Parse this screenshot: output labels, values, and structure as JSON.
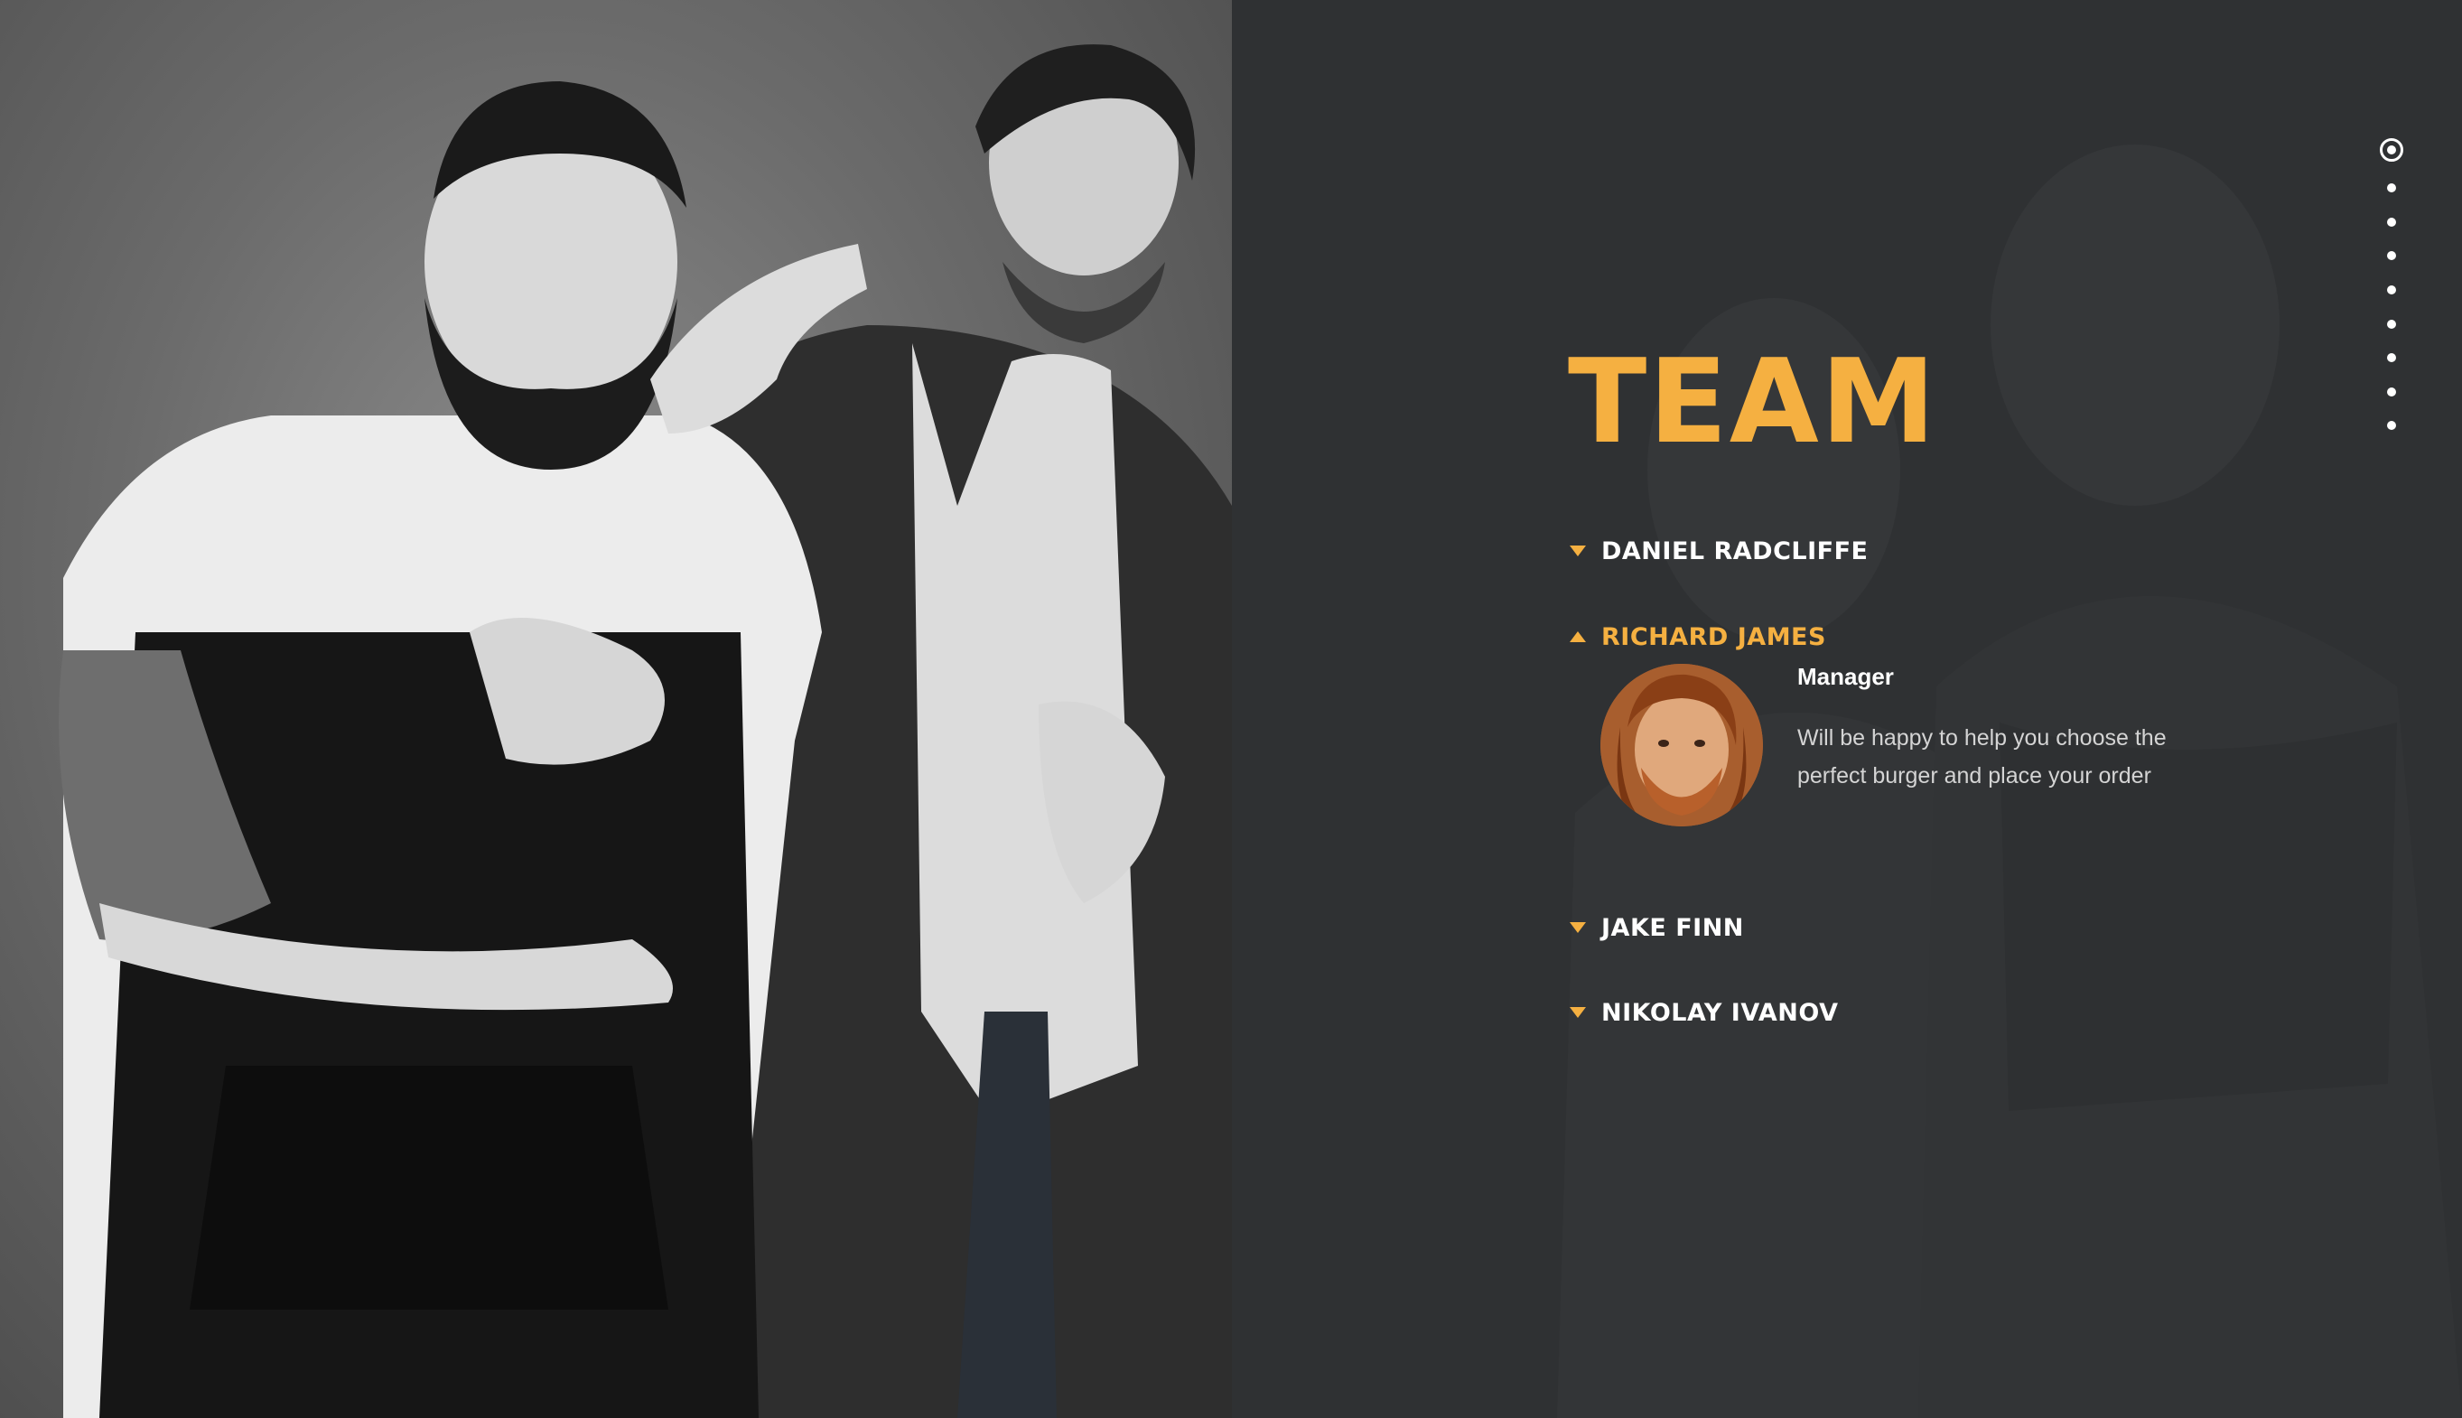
{
  "section": {
    "title": "TEAM"
  },
  "members": [
    {
      "name": "DANIEL RADCLIFFE",
      "expanded": false
    },
    {
      "name": "RICHARD JAMES",
      "expanded": true,
      "role": "Manager",
      "description": "Will be happy to help you choose the perfect burger and place your order",
      "avatar_icon": "bearded-man-portrait"
    },
    {
      "name": "JAKE FINN",
      "expanded": false
    },
    {
      "name": "NIKOLAY IVANOV",
      "expanded": false
    }
  ],
  "dot_nav": {
    "count": 9,
    "active_index": 0
  },
  "colors": {
    "accent": "#f5b041",
    "background": "#2f3133",
    "text": "#ffffff",
    "muted_text": "#d4d4d4"
  },
  "photo": {
    "icon": "team-photo",
    "style": "black-and-white"
  }
}
